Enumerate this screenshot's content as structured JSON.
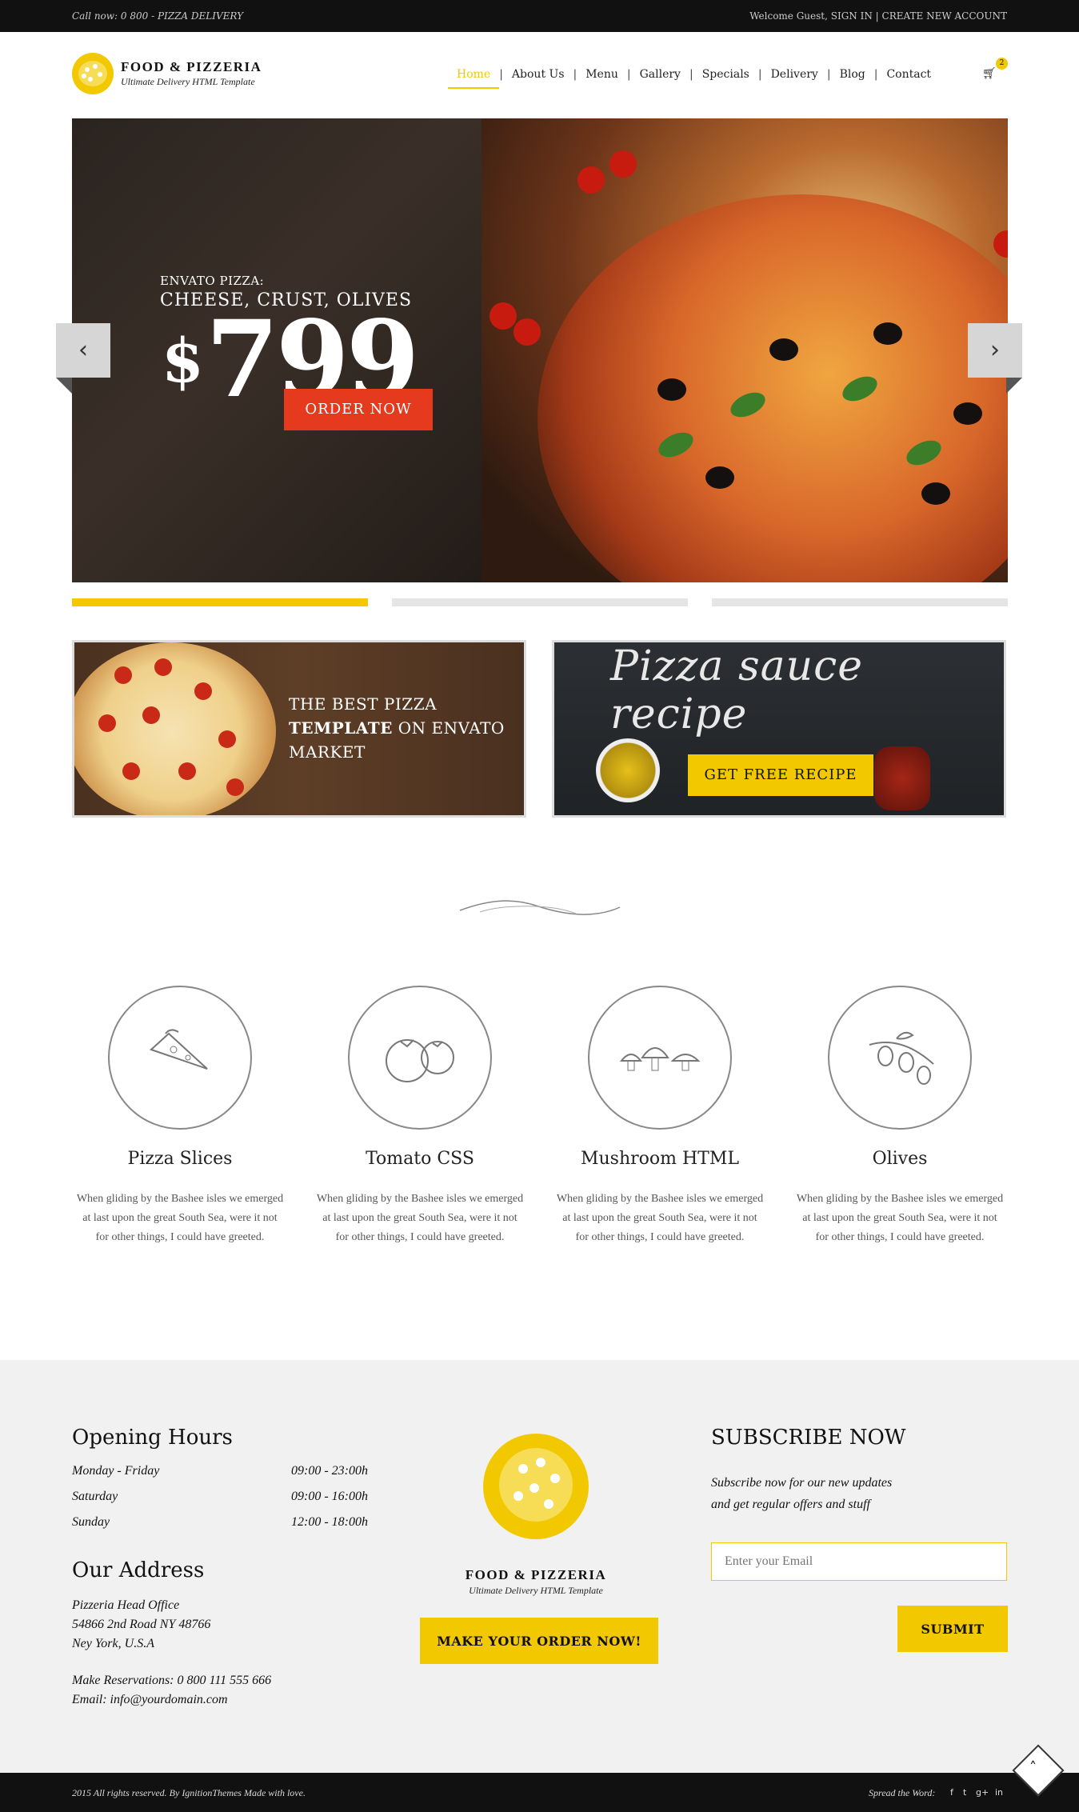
{
  "topbar": {
    "call": "Call now: 0 800 - PIZZA DELIVERY",
    "welcome": "Welcome Guest, ",
    "sign_in": "SIGN IN",
    "divider": " | ",
    "create": "CREATE NEW ACCOUNT"
  },
  "header": {
    "brand": "FOOD & PIZZERIA",
    "tagline": "Ultimate Delivery HTML Template",
    "nav": [
      "Home",
      "About Us",
      "Menu",
      "Gallery",
      "Specials",
      "Delivery",
      "Blog",
      "Contact"
    ],
    "active": "Home",
    "cart_count": "2"
  },
  "slider": {
    "eyebrow": "ENVATO PIZZA:",
    "headline": "CHEESE, CRUST, OLIVES",
    "currency": "$",
    "price": "799",
    "cta": "ORDER NOW",
    "prev_icon": "chevron-left-icon",
    "next_icon": "chevron-right-icon",
    "slides_total": 3,
    "slide_active": 1
  },
  "banners": {
    "left_line1": "THE BEST PIZZA",
    "left_bold": "TEMPLATE",
    "left_line2": " ON ENVATO",
    "left_line3": "MARKET",
    "right_title": "Pizza sauce recipe",
    "right_cta": "GET FREE RECIPE"
  },
  "features": [
    {
      "title": "Pizza Slices",
      "text": "When gliding by the Bashee isles we emerged at last upon the great South Sea, were it not for other things, I could have greeted.",
      "icon": "pizza-slice-icon"
    },
    {
      "title": "Tomato CSS",
      "text": "When gliding by the Bashee isles we emerged at last upon the great South Sea, were it not for other things, I could have greeted.",
      "icon": "tomato-icon"
    },
    {
      "title": "Mushroom HTML",
      "text": "When gliding by the Bashee isles we emerged at last upon the great South Sea, were it not for other things, I could have greeted.",
      "icon": "mushroom-icon"
    },
    {
      "title": "Olives",
      "text": "When gliding by the Bashee isles we emerged at last upon the great South Sea, were it not for other things, I could have greeted.",
      "icon": "olive-icon"
    }
  ],
  "footer": {
    "hours_title": "Opening Hours",
    "hours": [
      {
        "day": "Monday - Friday",
        "time": "09:00 - 23:00h"
      },
      {
        "day": "Saturday",
        "time": "09:00 - 16:00h"
      },
      {
        "day": "Sunday",
        "time": "12:00 - 18:00h"
      }
    ],
    "address_title": "Our Address",
    "address_lines": [
      "Pizzeria Head Office",
      "54866 2nd Road NY 48766",
      "Ney York, U.S.A"
    ],
    "reservations": "Make Reservations: 0 800 111 555 666",
    "email": "Email: info@yourdomain.com",
    "brand": "FOOD & PIZZERIA",
    "tagline": "Ultimate Delivery HTML Template",
    "order_cta": "MAKE YOUR ORDER NOW!",
    "subscribe_title": "SUBSCRIBE NOW",
    "subscribe_line1": "Subscribe now for our new updates",
    "subscribe_line2": "and get regular offers and stuff",
    "email_placeholder": "Enter your Email",
    "submit": "SUBMIT"
  },
  "bottombar": {
    "copyright": "2015 All rights reserved. By IgnitionThemes Made with love.",
    "spread": "Spread the Word:",
    "social": [
      "f",
      "t",
      "g+",
      "in"
    ]
  },
  "colors": {
    "accent": "#f2c800",
    "cta_red": "#e53a1e",
    "dark": "#111111"
  }
}
